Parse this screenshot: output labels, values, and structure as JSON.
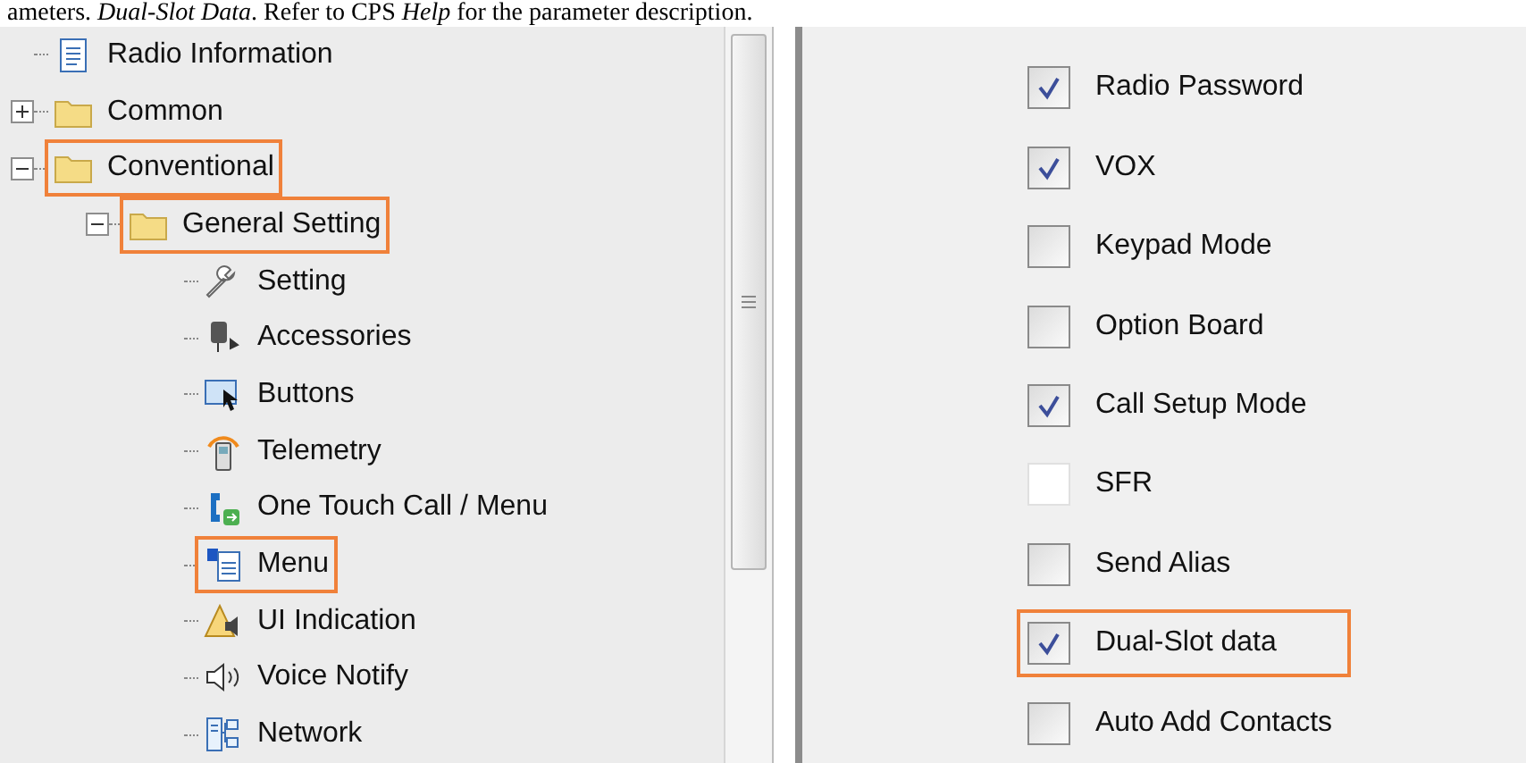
{
  "caption": "ameters. *Dual-Slot Data*. Refer to CPS *Help* for the parameter description.",
  "tree": [
    {
      "label": "Radio Information",
      "highlighted": false
    },
    {
      "label": "Common",
      "expanded": false,
      "highlighted": false
    },
    {
      "label": "Conventional",
      "expanded": true,
      "highlighted": true,
      "children": [
        {
          "label": "General Setting",
          "expanded": true,
          "highlighted": true,
          "children": [
            {
              "label": "Setting",
              "highlighted": false
            },
            {
              "label": "Accessories",
              "highlighted": false
            },
            {
              "label": "Buttons",
              "highlighted": false
            },
            {
              "label": "Telemetry",
              "highlighted": false
            },
            {
              "label": "One Touch Call / Menu",
              "highlighted": false
            },
            {
              "label": "Menu",
              "highlighted": true
            },
            {
              "label": "UI Indication",
              "highlighted": false
            },
            {
              "label": "Voice Notify",
              "highlighted": false
            },
            {
              "label": "Network",
              "highlighted": false
            }
          ]
        }
      ]
    }
  ],
  "options": [
    {
      "label": "Radio Password",
      "checked": true,
      "disabled": false,
      "highlighted": false
    },
    {
      "label": "VOX",
      "checked": true,
      "disabled": false,
      "highlighted": false
    },
    {
      "label": "Keypad Mode",
      "checked": false,
      "disabled": false,
      "highlighted": false
    },
    {
      "label": "Option Board",
      "checked": false,
      "disabled": false,
      "highlighted": false
    },
    {
      "label": "Call Setup Mode",
      "checked": true,
      "disabled": false,
      "highlighted": false
    },
    {
      "label": "SFR",
      "checked": false,
      "disabled": true,
      "highlighted": false
    },
    {
      "label": "Send Alias",
      "checked": false,
      "disabled": false,
      "highlighted": false
    },
    {
      "label": "Dual-Slot data",
      "checked": true,
      "disabled": false,
      "highlighted": true
    },
    {
      "label": "Auto Add Contacts",
      "checked": false,
      "disabled": false,
      "highlighted": false
    }
  ]
}
